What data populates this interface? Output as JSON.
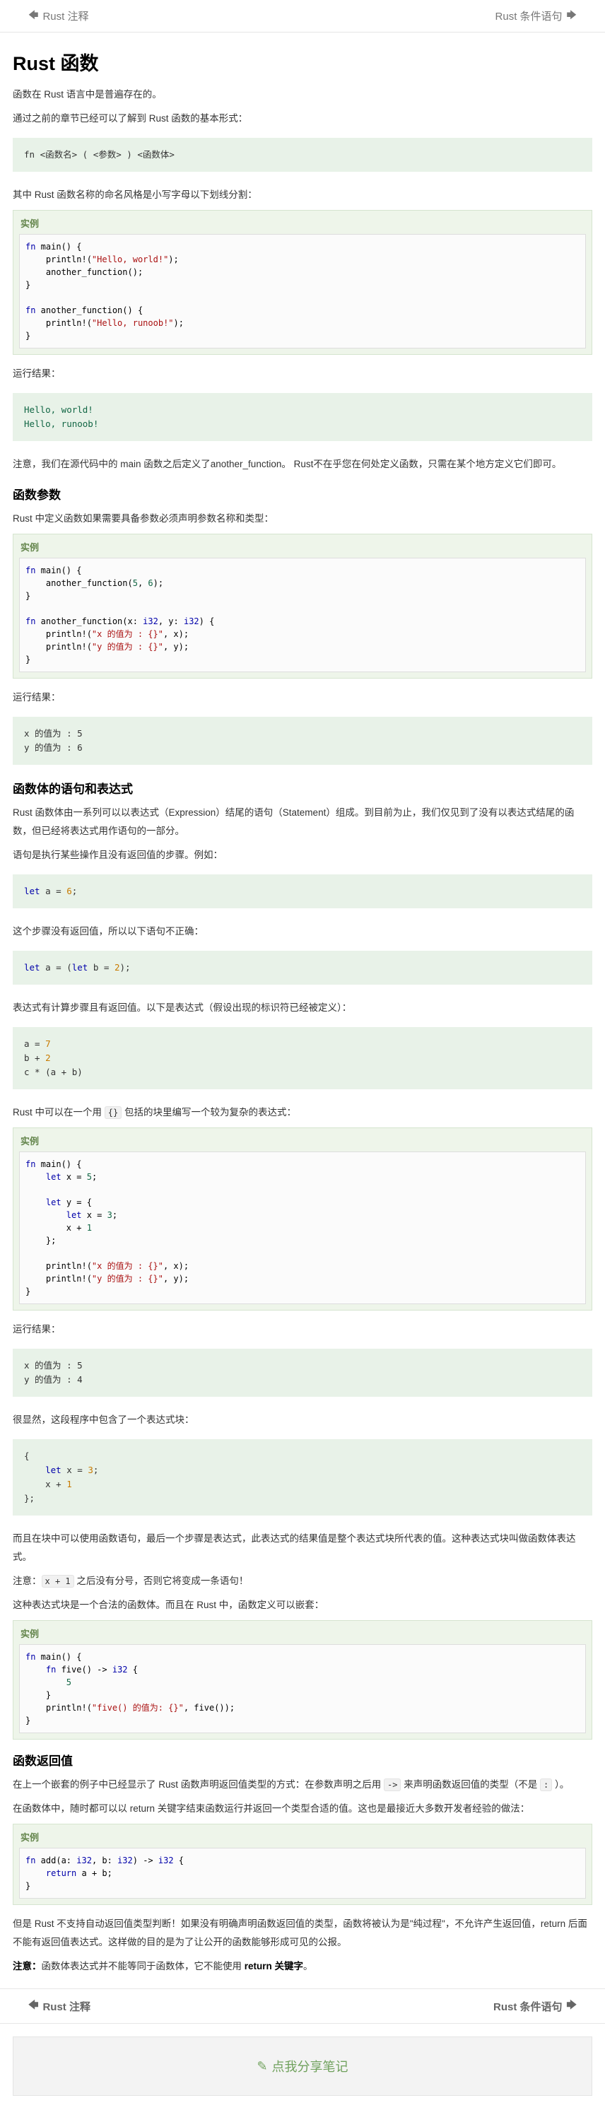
{
  "nav": {
    "prev": "Rust 注释",
    "next": "Rust 条件语句"
  },
  "title": "Rust 函数",
  "intro": [
    "函数在 Rust 语言中是普遍存在的。",
    "通过之前的章节已经可以了解到 Rust 函数的基本形式："
  ],
  "syntax": "fn <函数名> ( <参数> ) <函数体>",
  "naming": "其中 Rust 函数名称的命名风格是小写字母以下划线分割：",
  "example_label": "实例",
  "run_result_label": "运行结果：",
  "ex1_output": "Hello, world!\nHello, runoob!",
  "note1": "注意，我们在源代码中的 main 函数之后定义了another_function。 Rust不在乎您在何处定义函数，只需在某个地方定义它们即可。",
  "sec_params": {
    "title": "函数参数",
    "desc": "Rust 中定义函数如果需要具备参数必须声明参数名称和类型：",
    "output_line1": "x 的值为 : 5",
    "output_line2": "y 的值为 : 6"
  },
  "sec_stmt": {
    "title": "函数体的语句和表达式",
    "p1": "Rust 函数体由一系列可以以表达式（Expression）结尾的语句（Statement）组成。到目前为止，我们仅见到了没有以表达式结尾的函数，但已经将表达式用作语句的一部分。",
    "p2": "语句是执行某些操作且没有返回值的步骤。例如：",
    "p3": "这个步骤没有返回值，所以以下语句不正确：",
    "p4": "表达式有计算步骤且有返回值。以下是表达式（假设出现的标识符已经被定义）：",
    "p5a": "Rust 中可以在一个用 ",
    "p5code": "{}",
    "p5b": " 包括的块里编写一个较为复杂的表达式：",
    "output_line1": "x 的值为 : 5",
    "output_line2": "y 的值为 : 4",
    "p6": "很显然，这段程序中包含了一个表达式块：",
    "p7": "而且在块中可以使用函数语句，最后一个步骤是表达式，此表达式的结果值是整个表达式块所代表的值。这种表达式块叫做函数体表达式。",
    "p8a": "注意：",
    "p8code": "x + 1",
    "p8b": " 之后没有分号，否则它将变成一条语句！",
    "p9": "这种表达式块是一个合法的函数体。而且在 Rust 中，函数定义可以嵌套："
  },
  "sec_return": {
    "title": "函数返回值",
    "p1a": "在上一个嵌套的例子中已经显示了 Rust 函数声明返回值类型的方式：在参数声明之后用 ",
    "p1code": "->",
    "p1b": " 来声明函数返回值的类型（不是 ",
    "p1code2": ":",
    "p1c": " ）。",
    "p2": "在函数体中，随时都可以以 return 关键字结束函数运行并返回一个类型合适的值。这也是最接近大多数开发者经验的做法：",
    "p3": "但是 Rust 不支持自动返回值类型判断！如果没有明确声明函数返回值的类型，函数将被认为是\"纯过程\"，不允许产生返回值，return 后面不能有返回值表达式。这样做的目的是为了让公开的函数能够形成可见的公报。",
    "p4a": "注意：",
    "p4b": "函数体表达式并不能等同于函数体，它不能使用 ",
    "p4c": "return 关键字",
    "p4d": "。"
  },
  "share": "点我分享笔记"
}
